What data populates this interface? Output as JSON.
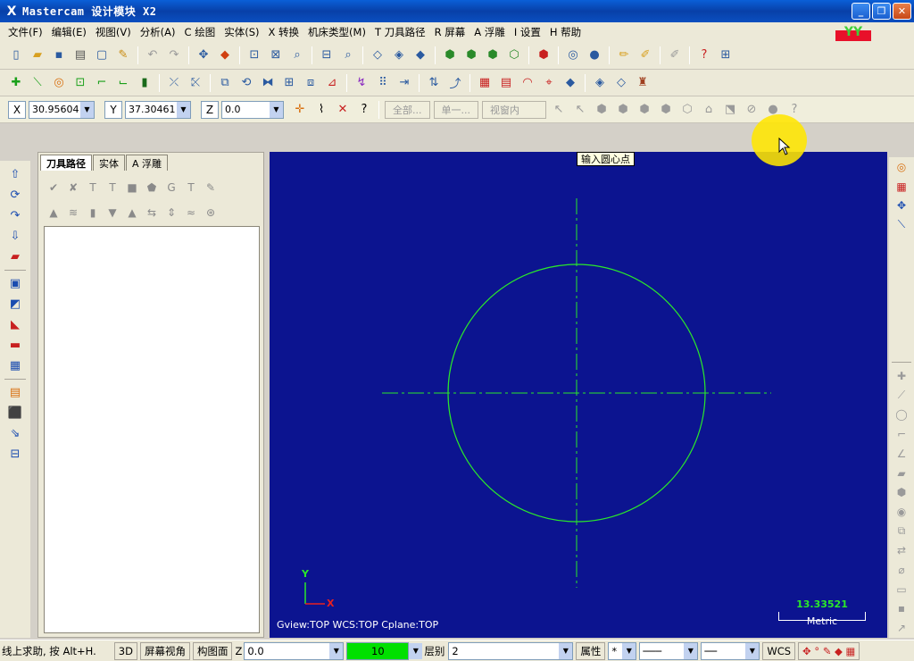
{
  "window": {
    "title": "Mastercam 设计模块  X2",
    "minimize": "_",
    "restore": "❐",
    "close": "✕"
  },
  "menu": [
    "文件(F)",
    "编辑(E)",
    "视图(V)",
    "分析(A)",
    "C 绘图",
    "实体(S)",
    "X 转换",
    "机床类型(M)",
    "T 刀具路径",
    "R 屏幕",
    "A 浮雕",
    "I 设置",
    "H 帮助"
  ],
  "brand": {
    "line1": "育碟",
    "line2": "软件",
    "mark": "YY"
  },
  "coords": {
    "x_label": "X",
    "x_value": "30.95604",
    "y_label": "Y",
    "y_value": "37.30461",
    "z_label": "Z",
    "z_value": "0.0"
  },
  "selection": {
    "all_label": "全部...",
    "single_label": "单一...",
    "window_mode": "视窗内"
  },
  "panel": {
    "tabs": [
      "刀具路径",
      "实体",
      "A 浮雕"
    ]
  },
  "viewport": {
    "tooltip": "输入圆心点",
    "view_info": "Gview:TOP   WCS:TOP   Cplane:TOP",
    "axis_y": "Y",
    "axis_x": "X",
    "scale_value": "13.33521",
    "scale_unit": "Metric",
    "colors": {
      "background": "#0c1490",
      "geometry": "#2ae82a",
      "axis": "#2ae82a"
    }
  },
  "statusbar": {
    "prompt": "线上求助, 按 Alt+H.",
    "mode_3d": "3D",
    "screen_view": "屏幕视角",
    "construction_plane": "构图面",
    "z_label": "Z",
    "z_value": "0.0",
    "color_value": "10",
    "level_label": "层别",
    "level_value": "2",
    "attributes": "属性",
    "wcs": "WCS"
  }
}
